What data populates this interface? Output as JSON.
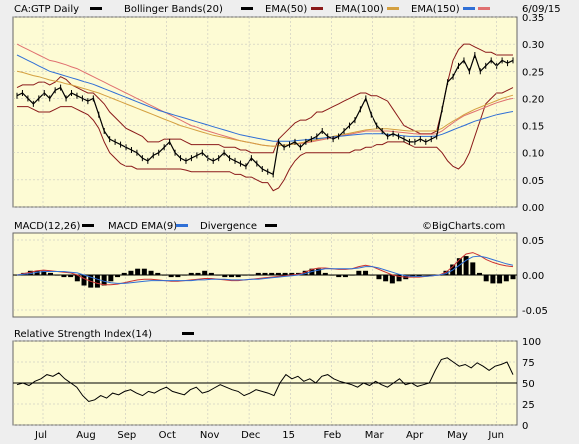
{
  "header": {
    "symbol_label": "CA:GTP Daily",
    "indicators": [
      {
        "label": "Bollinger Bands(20)",
        "color": "#000000"
      },
      {
        "label": "EMA(50)",
        "color": "#8b1a1a"
      },
      {
        "label": "EMA(100)",
        "color": "#d4a040"
      },
      {
        "label": "EMA(150)",
        "color": "#2f6fd6"
      }
    ],
    "date": "6/09/15",
    "extra_swatch_color": "#e07070"
  },
  "macd": {
    "labels": [
      {
        "label": "MACD(12,26)",
        "color": "#000000"
      },
      {
        "label": "MACD EMA(9)",
        "color": "#2f6fd6"
      },
      {
        "label": "Divergence",
        "color": "#8b1a1a"
      }
    ],
    "extra_swatch_color": "#000000",
    "watermark": "©BigCharts.com"
  },
  "rsi": {
    "label": "Relative Strength Index(14)",
    "swatch_color": "#000000"
  },
  "colors": {
    "panel_bg": "#fdfbd4",
    "price": "#000000",
    "bollinger": "#8b1a1a",
    "ema50": "#e07070",
    "ema100": "#d4a040",
    "ema150": "#2f6fd6",
    "macd_line": "#cc3333",
    "macd_signal": "#2f6fd6",
    "grid": "#bbbbbb"
  },
  "chart_data": [
    {
      "type": "line",
      "title": "CA:GTP Daily",
      "x_labels": [
        "Jul",
        "Aug",
        "Sep",
        "Oct",
        "Nov",
        "Dec",
        "15",
        "Feb",
        "Mar",
        "Apr",
        "May",
        "Jun"
      ],
      "y_ticks": [
        "0.35",
        "0.30",
        "0.25",
        "0.20",
        "0.15",
        "0.10",
        "0.05",
        "0.00"
      ],
      "ylim": [
        0.0,
        0.35
      ],
      "series": [
        {
          "name": "CA:GTP",
          "values": [
            0.205,
            0.21,
            0.2,
            0.19,
            0.2,
            0.21,
            0.2,
            0.215,
            0.22,
            0.2,
            0.21,
            0.205,
            0.2,
            0.195,
            0.2,
            0.17,
            0.14,
            0.125,
            0.12,
            0.115,
            0.11,
            0.105,
            0.1,
            0.09,
            0.085,
            0.095,
            0.1,
            0.11,
            0.12,
            0.1,
            0.09,
            0.085,
            0.09,
            0.095,
            0.1,
            0.09,
            0.085,
            0.09,
            0.1,
            0.09,
            0.085,
            0.08,
            0.075,
            0.09,
            0.08,
            0.07,
            0.065,
            0.06,
            0.12,
            0.11,
            0.115,
            0.12,
            0.11,
            0.12,
            0.125,
            0.13,
            0.14,
            0.13,
            0.125,
            0.13,
            0.14,
            0.15,
            0.16,
            0.18,
            0.2,
            0.17,
            0.15,
            0.14,
            0.13,
            0.135,
            0.13,
            0.125,
            0.12,
            0.12,
            0.125,
            0.12,
            0.125,
            0.13,
            0.18,
            0.23,
            0.24,
            0.26,
            0.27,
            0.25,
            0.28,
            0.25,
            0.26,
            0.27,
            0.26,
            0.27,
            0.265,
            0.27
          ]
        },
        {
          "name": "Bollinger Upper",
          "values": [
            0.22,
            0.225,
            0.225,
            0.225,
            0.23,
            0.23,
            0.225,
            0.23,
            0.24,
            0.235,
            0.225,
            0.22,
            0.215,
            0.21,
            0.21,
            0.2,
            0.19,
            0.175,
            0.165,
            0.155,
            0.145,
            0.14,
            0.135,
            0.13,
            0.12,
            0.12,
            0.12,
            0.125,
            0.125,
            0.125,
            0.125,
            0.12,
            0.115,
            0.115,
            0.115,
            0.115,
            0.115,
            0.115,
            0.11,
            0.11,
            0.11,
            0.105,
            0.105,
            0.1,
            0.1,
            0.1,
            0.1,
            0.1,
            0.125,
            0.135,
            0.145,
            0.155,
            0.16,
            0.16,
            0.165,
            0.175,
            0.175,
            0.18,
            0.185,
            0.19,
            0.195,
            0.2,
            0.205,
            0.21,
            0.21,
            0.205,
            0.205,
            0.2,
            0.195,
            0.18,
            0.165,
            0.15,
            0.145,
            0.14,
            0.135,
            0.135,
            0.135,
            0.14,
            0.18,
            0.23,
            0.27,
            0.29,
            0.3,
            0.3,
            0.295,
            0.29,
            0.285,
            0.285,
            0.28,
            0.28,
            0.28,
            0.28
          ]
        },
        {
          "name": "Bollinger Lower",
          "values": [
            0.185,
            0.185,
            0.185,
            0.18,
            0.175,
            0.175,
            0.175,
            0.18,
            0.185,
            0.185,
            0.185,
            0.18,
            0.175,
            0.17,
            0.16,
            0.145,
            0.12,
            0.1,
            0.09,
            0.08,
            0.075,
            0.075,
            0.07,
            0.07,
            0.07,
            0.07,
            0.07,
            0.07,
            0.07,
            0.07,
            0.07,
            0.068,
            0.065,
            0.065,
            0.065,
            0.065,
            0.065,
            0.065,
            0.065,
            0.065,
            0.06,
            0.06,
            0.055,
            0.055,
            0.05,
            0.045,
            0.045,
            0.03,
            0.035,
            0.05,
            0.07,
            0.085,
            0.095,
            0.1,
            0.1,
            0.1,
            0.1,
            0.1,
            0.1,
            0.1,
            0.1,
            0.1,
            0.105,
            0.105,
            0.11,
            0.11,
            0.115,
            0.115,
            0.12,
            0.12,
            0.12,
            0.12,
            0.115,
            0.11,
            0.11,
            0.11,
            0.11,
            0.11,
            0.1,
            0.085,
            0.075,
            0.07,
            0.08,
            0.1,
            0.13,
            0.16,
            0.19,
            0.2,
            0.21,
            0.21,
            0.215,
            0.22
          ]
        },
        {
          "name": "EMA(50)",
          "values": [
            0.3,
            0.295,
            0.29,
            0.285,
            0.28,
            0.275,
            0.27,
            0.268,
            0.265,
            0.262,
            0.258,
            0.255,
            0.25,
            0.245,
            0.24,
            0.235,
            0.23,
            0.225,
            0.22,
            0.215,
            0.21,
            0.205,
            0.2,
            0.195,
            0.19,
            0.185,
            0.18,
            0.175,
            0.17,
            0.165,
            0.16,
            0.155,
            0.15,
            0.147,
            0.143,
            0.14,
            0.137,
            0.134,
            0.131,
            0.128,
            0.125,
            0.122,
            0.12,
            0.118,
            0.116,
            0.114,
            0.113,
            0.112,
            0.113,
            0.114,
            0.115,
            0.116,
            0.117,
            0.118,
            0.12,
            0.122,
            0.124,
            0.126,
            0.128,
            0.13,
            0.132,
            0.134,
            0.136,
            0.138,
            0.14,
            0.14,
            0.14,
            0.14,
            0.14,
            0.139,
            0.138,
            0.137,
            0.136,
            0.135,
            0.134,
            0.134,
            0.134,
            0.135,
            0.14,
            0.148,
            0.155,
            0.162,
            0.168,
            0.172,
            0.176,
            0.18,
            0.184,
            0.188,
            0.192,
            0.195,
            0.198,
            0.2
          ]
        },
        {
          "name": "EMA(100)",
          "values": [
            0.25,
            0.248,
            0.245,
            0.242,
            0.24,
            0.237,
            0.234,
            0.232,
            0.23,
            0.227,
            0.225,
            0.222,
            0.219,
            0.216,
            0.213,
            0.21,
            0.206,
            0.202,
            0.198,
            0.194,
            0.19,
            0.186,
            0.182,
            0.178,
            0.174,
            0.17,
            0.166,
            0.162,
            0.158,
            0.154,
            0.15,
            0.147,
            0.144,
            0.141,
            0.138,
            0.135,
            0.132,
            0.13,
            0.128,
            0.126,
            0.124,
            0.122,
            0.12,
            0.118,
            0.116,
            0.114,
            0.113,
            0.112,
            0.113,
            0.114,
            0.115,
            0.116,
            0.118,
            0.12,
            0.122,
            0.124,
            0.126,
            0.128,
            0.13,
            0.132,
            0.134,
            0.136,
            0.138,
            0.14,
            0.142,
            0.143,
            0.144,
            0.144,
            0.144,
            0.143,
            0.142,
            0.141,
            0.14,
            0.14,
            0.14,
            0.14,
            0.14,
            0.141,
            0.145,
            0.152,
            0.158,
            0.164,
            0.17,
            0.175,
            0.18,
            0.184,
            0.188,
            0.192,
            0.196,
            0.2,
            0.203,
            0.206
          ]
        },
        {
          "name": "EMA(150)",
          "values": [
            0.28,
            0.275,
            0.27,
            0.265,
            0.26,
            0.255,
            0.25,
            0.247,
            0.244,
            0.241,
            0.238,
            0.235,
            0.232,
            0.229,
            0.226,
            0.222,
            0.218,
            0.214,
            0.21,
            0.206,
            0.202,
            0.198,
            0.194,
            0.19,
            0.186,
            0.182,
            0.178,
            0.175,
            0.172,
            0.169,
            0.166,
            0.163,
            0.16,
            0.157,
            0.154,
            0.151,
            0.148,
            0.145,
            0.142,
            0.139,
            0.136,
            0.133,
            0.131,
            0.129,
            0.127,
            0.125,
            0.123,
            0.121,
            0.121,
            0.121,
            0.121,
            0.122,
            0.123,
            0.124,
            0.125,
            0.126,
            0.127,
            0.128,
            0.129,
            0.13,
            0.131,
            0.132,
            0.133,
            0.134,
            0.135,
            0.135,
            0.135,
            0.135,
            0.134,
            0.133,
            0.132,
            0.131,
            0.13,
            0.13,
            0.13,
            0.13,
            0.13,
            0.131,
            0.134,
            0.138,
            0.142,
            0.146,
            0.15,
            0.154,
            0.158,
            0.161,
            0.164,
            0.167,
            0.17,
            0.172,
            0.174,
            0.176
          ]
        }
      ]
    },
    {
      "type": "line",
      "title": "MACD(12,26)",
      "y_ticks": [
        "0.05",
        "0.00",
        "-0.05"
      ],
      "ylim": [
        -0.06,
        0.06
      ],
      "series": [
        {
          "name": "MACD(12,26)",
          "values": [
            0.0,
            0.002,
            0.004,
            0.006,
            0.007,
            0.006,
            0.005,
            0.004,
            0.003,
            0.0,
            -0.005,
            -0.009,
            -0.012,
            -0.014,
            -0.014,
            -0.013,
            -0.011,
            -0.009,
            -0.007,
            -0.006,
            -0.006,
            -0.007,
            -0.008,
            -0.009,
            -0.009,
            -0.008,
            -0.007,
            -0.006,
            -0.005,
            -0.005,
            -0.006,
            -0.007,
            -0.008,
            -0.008,
            -0.007,
            -0.006,
            -0.005,
            -0.004,
            -0.003,
            -0.002,
            -0.001,
            0.0,
            0.001,
            0.004,
            0.008,
            0.01,
            0.01,
            0.009,
            0.008,
            0.008,
            0.009,
            0.012,
            0.014,
            0.012,
            0.008,
            0.004,
            0.0,
            -0.002,
            -0.003,
            -0.003,
            -0.003,
            -0.002,
            -0.001,
            0.0,
            0.004,
            0.012,
            0.022,
            0.03,
            0.032,
            0.028,
            0.022,
            0.018,
            0.015,
            0.013,
            0.012
          ]
        },
        {
          "name": "MACD EMA(9)",
          "values": [
            0.0,
            0.001,
            0.002,
            0.004,
            0.005,
            0.005,
            0.005,
            0.005,
            0.004,
            0.003,
            0.0,
            -0.003,
            -0.006,
            -0.009,
            -0.011,
            -0.012,
            -0.012,
            -0.011,
            -0.01,
            -0.009,
            -0.008,
            -0.008,
            -0.008,
            -0.008,
            -0.008,
            -0.008,
            -0.008,
            -0.007,
            -0.007,
            -0.006,
            -0.006,
            -0.006,
            -0.007,
            -0.007,
            -0.007,
            -0.006,
            -0.006,
            -0.005,
            -0.004,
            -0.003,
            -0.002,
            -0.001,
            0.0,
            0.002,
            0.005,
            0.007,
            0.009,
            0.009,
            0.009,
            0.009,
            0.009,
            0.01,
            0.012,
            0.012,
            0.01,
            0.007,
            0.004,
            0.001,
            -0.001,
            -0.002,
            -0.002,
            -0.002,
            -0.001,
            0.0,
            0.002,
            0.007,
            0.014,
            0.021,
            0.026,
            0.027,
            0.025,
            0.022,
            0.019,
            0.016,
            0.014
          ]
        },
        {
          "name": "Divergence",
          "values": [
            0.0,
            0.001,
            0.002,
            0.002,
            0.002,
            0.001,
            0.0,
            -0.001,
            -0.001,
            -0.003,
            -0.005,
            -0.006,
            -0.006,
            -0.005,
            -0.003,
            -0.001,
            0.001,
            0.002,
            0.003,
            0.003,
            0.002,
            0.001,
            0.0,
            -0.001,
            -0.001,
            0.0,
            0.001,
            0.001,
            0.002,
            0.001,
            0.0,
            -0.001,
            -0.001,
            -0.001,
            0.0,
            0.0,
            0.001,
            0.001,
            0.001,
            0.001,
            0.001,
            0.001,
            0.001,
            0.002,
            0.003,
            0.003,
            0.001,
            0.0,
            -0.001,
            -0.001,
            0.0,
            0.002,
            0.002,
            0.0,
            -0.002,
            -0.003,
            -0.004,
            -0.003,
            -0.002,
            -0.001,
            -0.001,
            0.0,
            0.0,
            0.0,
            0.002,
            0.005,
            0.008,
            0.009,
            0.006,
            0.001,
            -0.003,
            -0.004,
            -0.004,
            -0.003,
            -0.002
          ]
        }
      ]
    },
    {
      "type": "line",
      "title": "Relative Strength Index(14)",
      "y_ticks": [
        "100",
        "75",
        "50",
        "25",
        "0"
      ],
      "ylim": [
        0,
        100
      ],
      "series": [
        {
          "name": "Relative Strength Index(14)",
          "values": [
            48,
            50,
            47,
            52,
            55,
            60,
            58,
            62,
            55,
            50,
            45,
            35,
            28,
            30,
            35,
            32,
            38,
            36,
            40,
            42,
            38,
            35,
            40,
            38,
            42,
            45,
            40,
            38,
            36,
            42,
            45,
            38,
            40,
            44,
            48,
            45,
            42,
            40,
            35,
            38,
            42,
            40,
            38,
            35,
            50,
            60,
            55,
            58,
            52,
            55,
            50,
            58,
            60,
            55,
            52,
            50,
            48,
            45,
            50,
            47,
            52,
            48,
            45,
            50,
            55,
            48,
            50,
            46,
            48,
            50,
            65,
            78,
            80,
            75,
            70,
            72,
            68,
            74,
            70,
            65,
            70,
            72,
            75,
            60
          ]
        }
      ]
    }
  ]
}
